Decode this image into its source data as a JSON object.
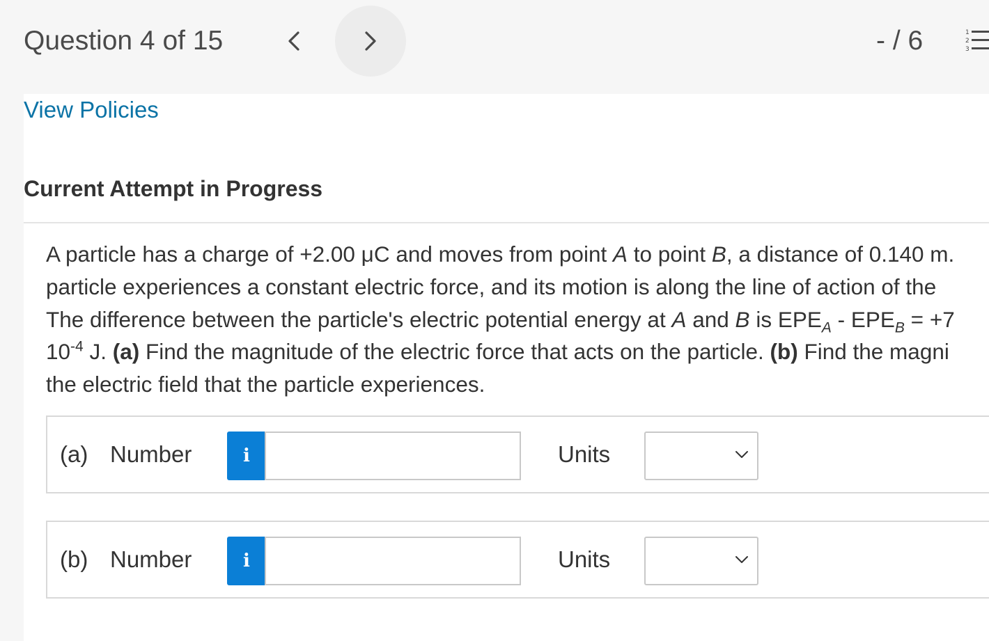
{
  "header": {
    "question_counter": "Question 4 of 15",
    "prev_icon": "chevron-left-icon",
    "next_icon": "chevron-right-icon",
    "score": "- / 6",
    "list_icon": "numbered-list-icon"
  },
  "links": {
    "view_policies": "View Policies"
  },
  "attempt": {
    "heading": "Current Attempt in Progress"
  },
  "question": {
    "l1_a": "A particle has a charge of +2.00 μC and moves from point ",
    "l1_b": "A",
    "l1_c": " to point ",
    "l1_d": "B",
    "l1_e": ", a distance of 0.140 m.",
    "l2": "particle experiences a constant electric force, and its motion is along the line of action of the",
    "l3_a": "The difference between the particle's electric potential energy at ",
    "l3_b": "A",
    "l3_c": " and ",
    "l3_d": "B",
    "l3_e": " is EPE",
    "l3_sub1": "A",
    "l3_f": " - EPE",
    "l3_sub2": "B",
    "l3_g": " = +7",
    "l4_a": "10",
    "l4_sup": "-4",
    "l4_b": " J. ",
    "l4_c": "(a)",
    "l4_d": " Find the magnitude of the electric force that acts on the particle. ",
    "l4_e": "(b)",
    "l4_f": " Find the magni",
    "l5": "the electric field that the particle experiences."
  },
  "answers": [
    {
      "part": "(a)",
      "number_label": "Number",
      "info_glyph": "i",
      "value": "",
      "units_label": "Units",
      "units_selected": ""
    },
    {
      "part": "(b)",
      "number_label": "Number",
      "info_glyph": "i",
      "value": "",
      "units_label": "Units",
      "units_selected": ""
    }
  ],
  "colors": {
    "link": "#0b73a6",
    "info_button": "#0b7fd6",
    "topbar_bg": "#f6f6f6"
  }
}
